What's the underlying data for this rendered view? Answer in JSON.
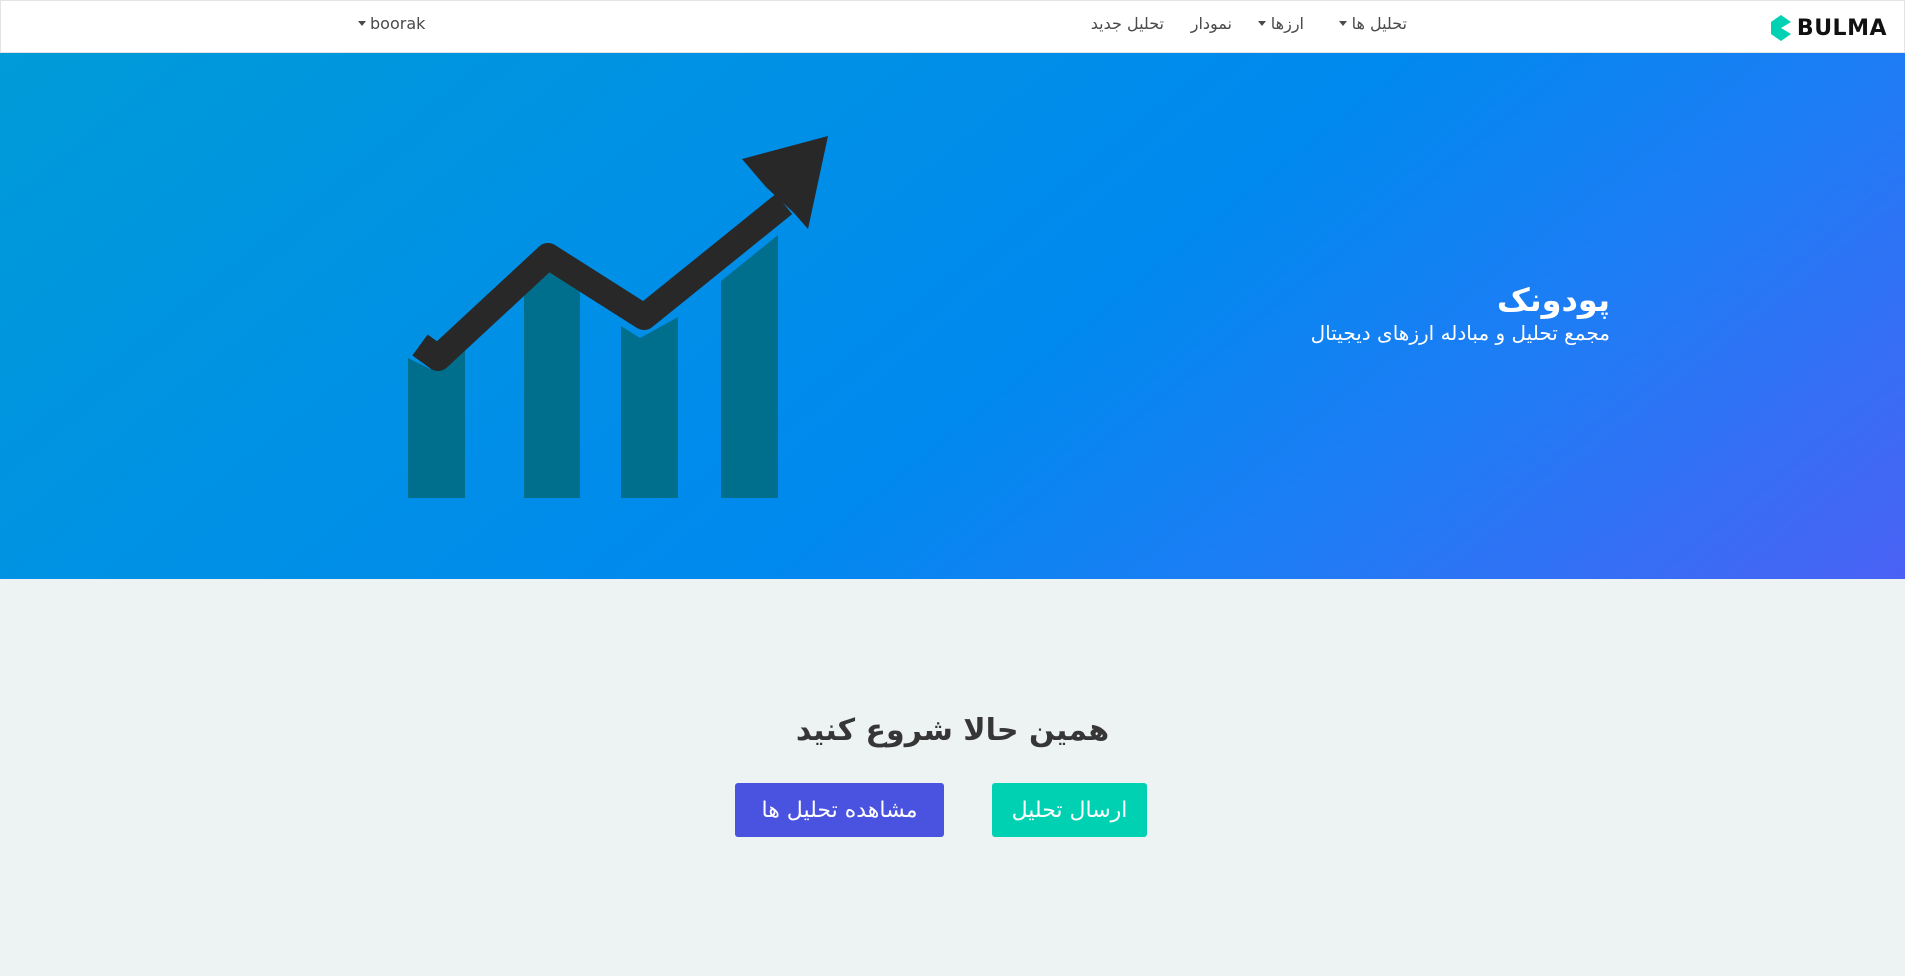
{
  "navbar": {
    "brand": "BULMA",
    "items": [
      {
        "label": "تحلیل ها",
        "dropdown": true
      },
      {
        "label": "ارزها",
        "dropdown": true
      },
      {
        "label": "نمودار",
        "dropdown": false
      },
      {
        "label": "تحلیل جدید",
        "dropdown": false
      }
    ],
    "user": {
      "name": "boorak",
      "dropdown": true
    }
  },
  "hero": {
    "title": "پودونک",
    "subtitle": "مجمع تحلیل و مبادله ارزهای دیجیتال",
    "illustration_icon": "growth-chart-icon"
  },
  "cta": {
    "title": "همین حالا شروع کنید",
    "view_button": "مشاهده تحلیل ها",
    "send_button": "ارسال تحلیل"
  },
  "colors": {
    "hero_gradient_start": "#009bd8",
    "hero_gradient_end": "#4a62f5",
    "brand": "#00d1b2",
    "view_button": "#4a52e0",
    "send_button": "#00d1b2",
    "section_bg": "#edf2f2"
  }
}
